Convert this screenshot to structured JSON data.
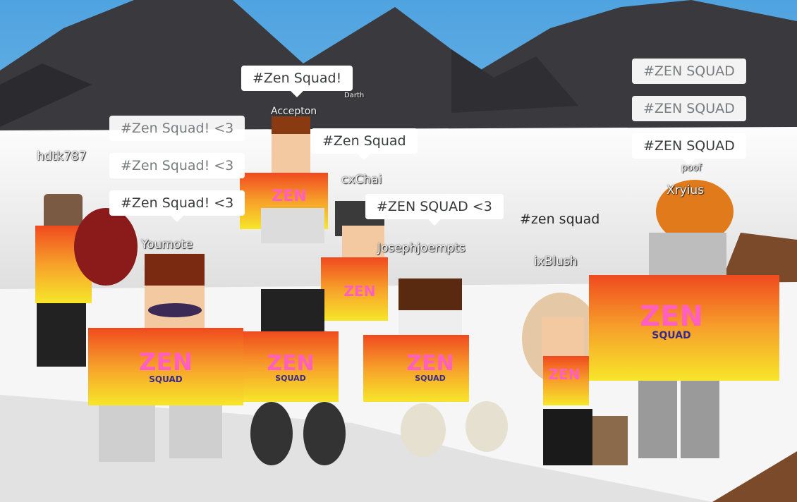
{
  "players": [
    {
      "name": "hdtk787"
    },
    {
      "name": "Youmote"
    },
    {
      "name": "Accepton"
    },
    {
      "name": "Darth"
    },
    {
      "name": "cxChai"
    },
    {
      "name": "Josephjoempts"
    },
    {
      "name": "ixBlush"
    },
    {
      "name": "poof"
    },
    {
      "name": "Xryius"
    }
  ],
  "chat_bubbles": [
    {
      "speaker": "Youmote",
      "text": "#Zen Squad! <3"
    },
    {
      "speaker": "Youmote",
      "text": "#Zen Squad! <3"
    },
    {
      "speaker": "Youmote",
      "text": "#Zen Squad! <3"
    },
    {
      "speaker": "Accepton",
      "text": "#Zen Squad!"
    },
    {
      "speaker": "cxChai",
      "text": "#Zen Squad"
    },
    {
      "speaker": "Josephjoempts",
      "text": "#ZEN SQUAD <3"
    },
    {
      "speaker": "ixBlush",
      "text": "#zen squad"
    },
    {
      "speaker": "Xryius",
      "text": "#ZEN SQUAD"
    },
    {
      "speaker": "Xryius",
      "text": "#ZEN SQUAD"
    },
    {
      "speaker": "Xryius",
      "text": "#ZEN SQUAD"
    }
  ],
  "shirt_logo": {
    "line1": "ZEN",
    "line2": "SQUAD"
  },
  "colors": {
    "sky": "#6db6e8",
    "mountain": "#3a3a3e",
    "snow": "#f3f3f3",
    "shirt_top": "#f04a1f",
    "shirt_bottom": "#f7e62a"
  }
}
